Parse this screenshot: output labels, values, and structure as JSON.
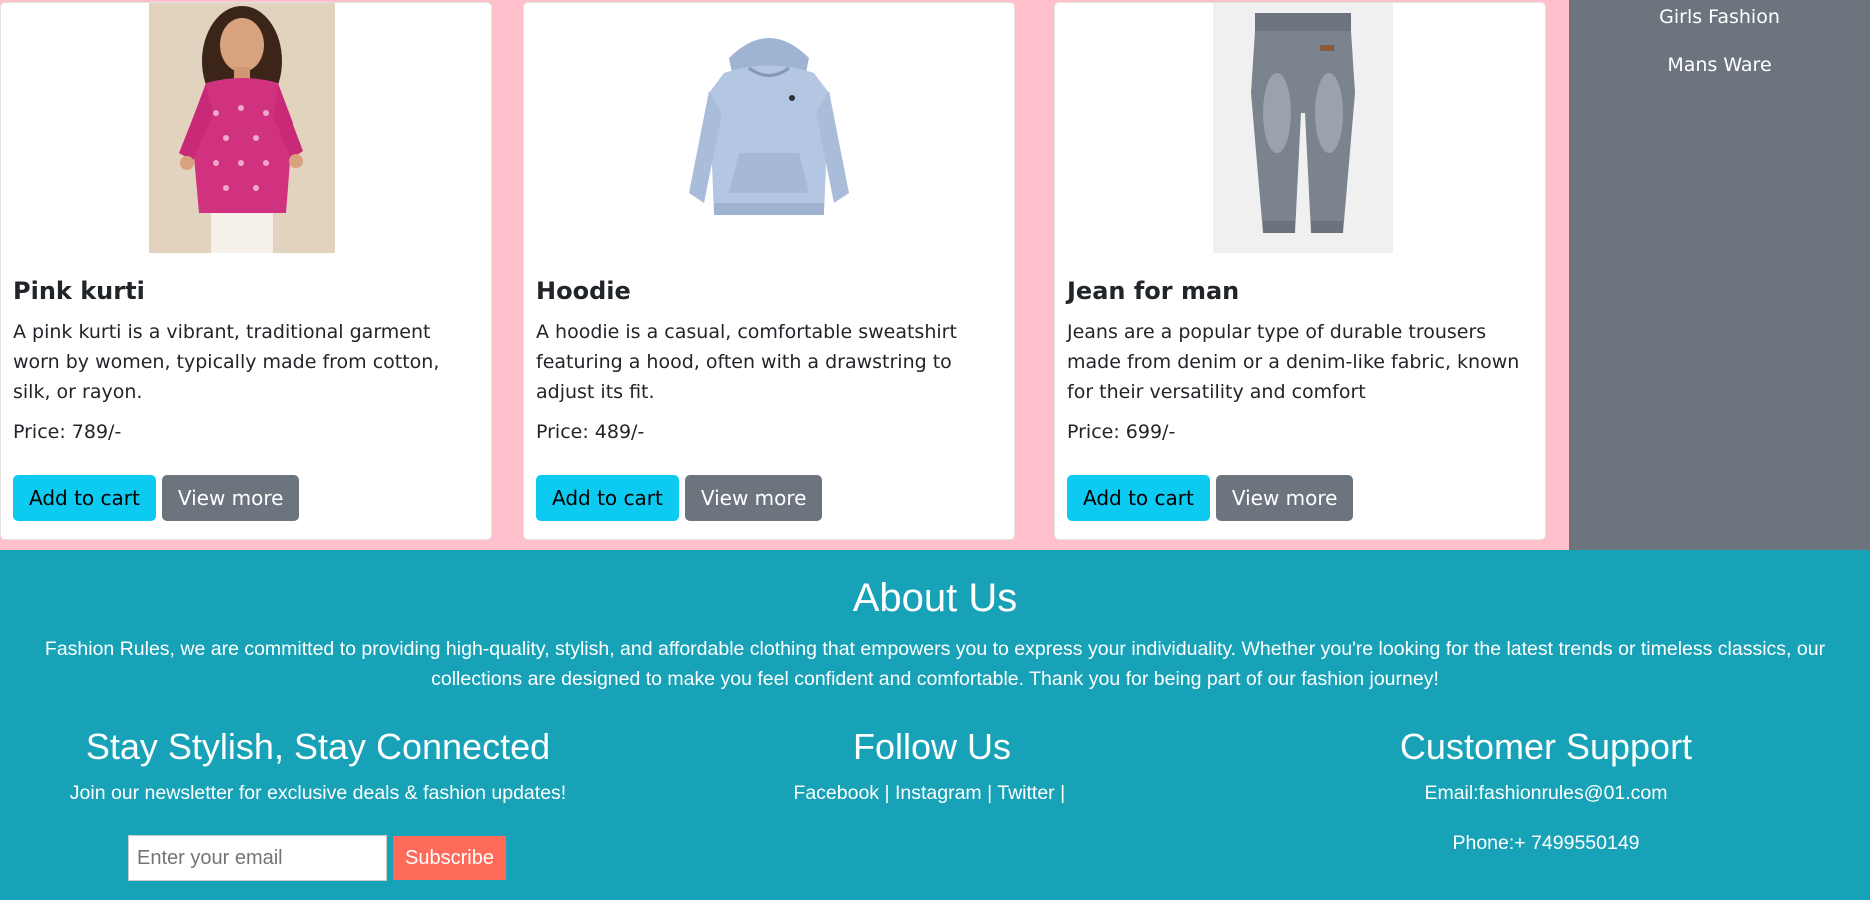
{
  "products": [
    {
      "title": "Pink kurti",
      "description": "A pink kurti is a vibrant, traditional garment worn by women, typically made from cotton, silk, or rayon.",
      "price": "Price: 789/-",
      "image": "pink-kurti-image"
    },
    {
      "title": "Hoodie",
      "description": "A hoodie is a casual, comfortable sweatshirt featuring a hood, often with a drawstring to adjust its fit.",
      "price": "Price: 489/-",
      "image": "hoodie-image"
    },
    {
      "title": "Jean for man",
      "description": "Jeans are a popular type of durable trousers made from denim or a denim-like fabric, known for their versatility and comfort",
      "price": "Price: 699/-",
      "image": "jeans-image"
    }
  ],
  "buttons": {
    "add_to_cart": "Add to cart",
    "view_more": "View more"
  },
  "sidebar": {
    "items": [
      "Girls Fashion",
      "Mans Ware"
    ]
  },
  "footer": {
    "about_title": "About Us",
    "about_text": "Fashion Rules, we are committed to providing high-quality, stylish, and affordable clothing that empowers you to express your individuality. Whether you're looking for the latest trends or timeless classics, our collections are designed to make you feel confident and comfortable. Thank you for being part of our fashion journey!",
    "newsletter": {
      "title": "Stay Stylish, Stay Connected",
      "text": "Join our newsletter for exclusive deals & fashion updates!",
      "placeholder": "Enter your email",
      "button": "Subscribe"
    },
    "follow": {
      "title": "Follow Us",
      "links": [
        "Facebook",
        "Instagram",
        "Twitter"
      ],
      "separator": " | "
    },
    "support": {
      "title": "Customer Support",
      "email": "Email:fashionrules@01.com",
      "phone": "Phone:+ 7499550149"
    }
  },
  "colors": {
    "page_bg": "#ffc0cb",
    "sidebar_bg": "#6c757d",
    "footer_bg": "#17a2b8",
    "cart_button": "#0dcaf0",
    "view_button": "#6c757d",
    "subscribe_button": "#ff6b5b"
  }
}
